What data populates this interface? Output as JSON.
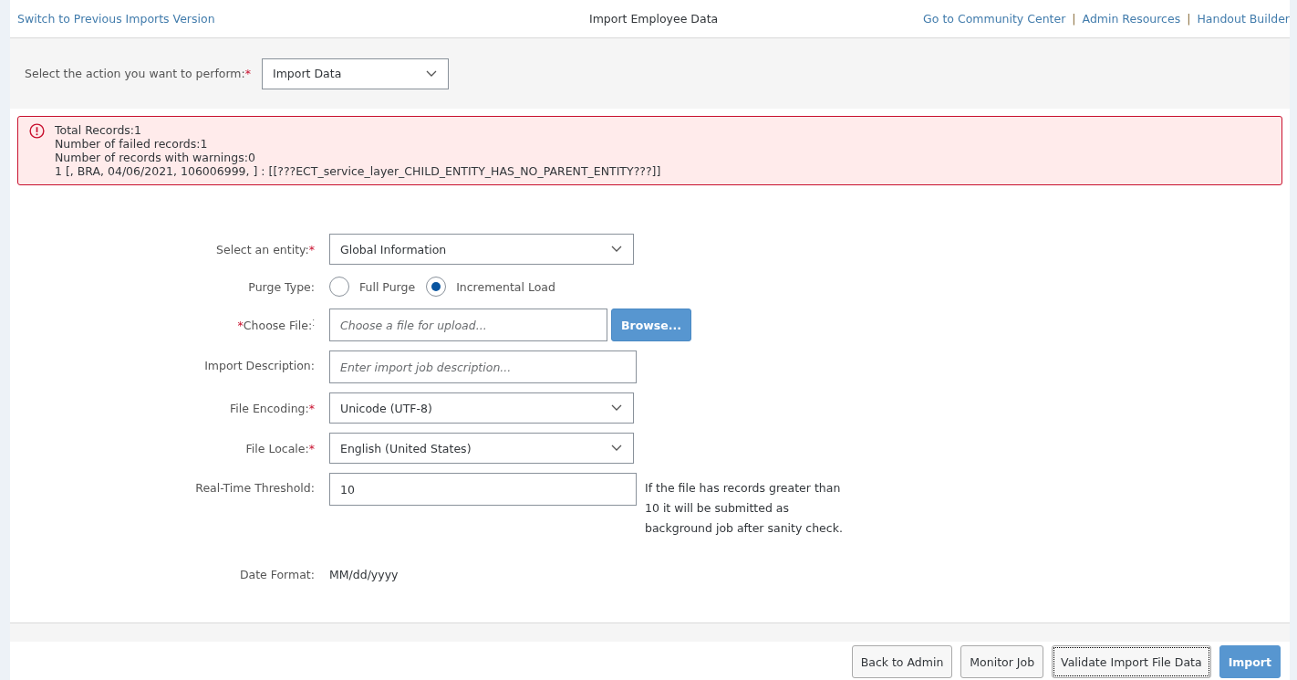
{
  "header": {
    "left_link": "Switch to Previous Imports Version",
    "title": "Import Employee Data",
    "links": [
      "Go to Community Center",
      "Admin Resources",
      "Handout Builder"
    ],
    "separators": [
      "|",
      "|"
    ]
  },
  "action": {
    "label": "Select the action you want to perform:",
    "mark": "*",
    "value": "Import Data"
  },
  "error": {
    "lines": [
      "Total Records:1",
      "Number of failed records:1",
      "Number of records with warnings:0",
      "1 [, BRA, 04/06/2021, 106006999, ] : [[???ECT_service_layer_CHILD_ENTITY_HAS_NO_PARENT_ENTITY???]]"
    ]
  },
  "form": [
    {
      "kind": "select",
      "label": "Select an entity:",
      "mark": "*",
      "value": "Global Information"
    },
    {
      "kind": "radio",
      "label": "Purge Type:",
      "options": [
        {
          "label": "Full Purge",
          "selected": false
        },
        {
          "label": "Incremental Load",
          "selected": true
        }
      ]
    },
    {
      "kind": "file",
      "label": "Choose File:",
      "suffix": "⁚",
      "leading_mark": "*",
      "placeholder": "Choose a file for upload...",
      "button": "Browse..."
    },
    {
      "kind": "text",
      "label": "Import Description:",
      "placeholder": "Enter import job description..."
    },
    {
      "kind": "select",
      "label": "File Encoding:",
      "mark": "*",
      "value": "Unicode (UTF-8)"
    },
    {
      "kind": "select",
      "label": "File Locale:",
      "mark": "*",
      "value": "English (United States)"
    },
    {
      "kind": "text",
      "label": "Real-Time Threshold:",
      "value": "10",
      "hint": "If the file has records greater than 10 it will be submitted as background job after sanity check."
    },
    {
      "kind": "static",
      "label": "Date Format:",
      "value": "MM/dd/yyyy"
    }
  ],
  "buttons": [
    {
      "label": "Back to Admin",
      "kind": "default"
    },
    {
      "label": "Monitor Job",
      "kind": "default"
    },
    {
      "label": "Validate Import File Data",
      "kind": "focused"
    },
    {
      "label": "Import",
      "kind": "primary"
    }
  ]
}
